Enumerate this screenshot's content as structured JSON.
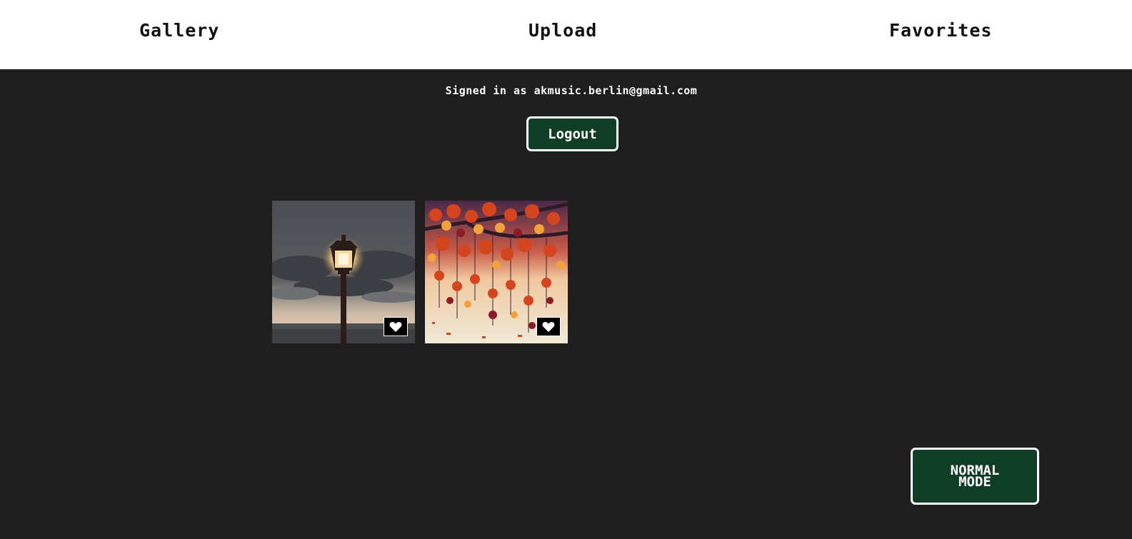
{
  "nav": {
    "gallery": "Gallery",
    "upload": "Upload",
    "favorites": "Favorites"
  },
  "account": {
    "signed_in_text": "Signed in as akmusic.berlin@gmail.com",
    "logout_label": "Logout"
  },
  "gallery": {
    "items": [
      {
        "subject": "street lamp at dusk, pixel art",
        "favorite_icon": "heart-icon"
      },
      {
        "subject": "red maple leaves falling, pixel art",
        "favorite_icon": "heart-icon"
      }
    ]
  },
  "mode_toggle": {
    "label": "NORMAL MODE"
  },
  "colors": {
    "background": "#1e1e1e",
    "nav_background": "#ffffff",
    "button_green": "#0f3d25",
    "button_border": "#ffffff"
  }
}
